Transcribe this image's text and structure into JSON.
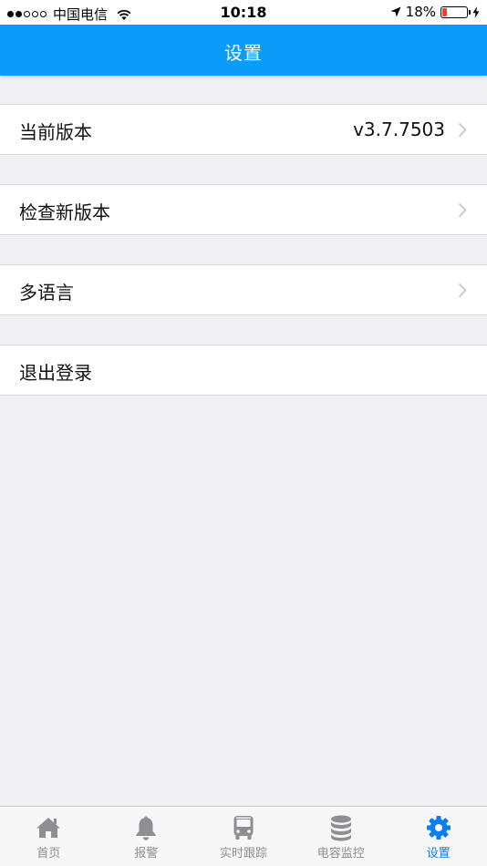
{
  "status_bar": {
    "carrier": "中国电信",
    "time": "10:18",
    "battery": "18%",
    "battery_level": 0.18,
    "signal_strength_dots": 2
  },
  "nav": {
    "title": "设置"
  },
  "rows": [
    {
      "label": "当前版本",
      "value": "v3.7.7503"
    },
    {
      "label": "检查新版本"
    },
    {
      "label": "多语言"
    },
    {
      "label": "退出登录"
    }
  ],
  "tabs": [
    {
      "label": "首页",
      "icon": "home-icon",
      "active": false
    },
    {
      "label": "报警",
      "icon": "bell-icon",
      "active": false
    },
    {
      "label": "实时跟踪",
      "icon": "bus-icon",
      "active": false
    },
    {
      "label": "电容监控",
      "icon": "database-icon",
      "active": false
    },
    {
      "label": "设置",
      "icon": "gear-icon",
      "active": true
    }
  ],
  "colors": {
    "accent": "#0b9cfa",
    "active_tab": "#0b7ff0",
    "inactive_tab": "#8e8e93",
    "background": "#efeff4",
    "battery_low": "#ff3b30"
  }
}
